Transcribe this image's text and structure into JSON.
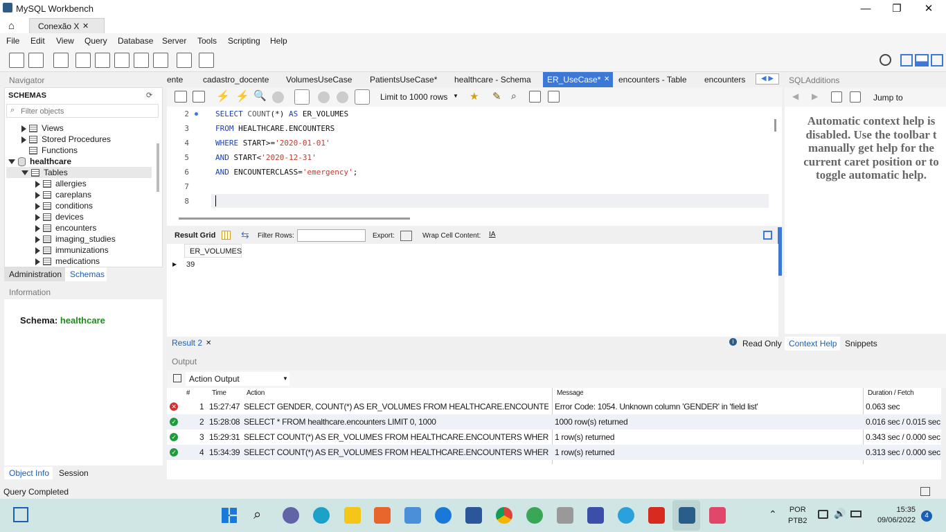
{
  "window": {
    "title": "MySQL Workbench",
    "min": "—",
    "max": "❐",
    "close": "✕"
  },
  "conn_tab": {
    "label": "Conexão X",
    "close": "✕"
  },
  "menu": [
    "File",
    "Edit",
    "View",
    "Query",
    "Database",
    "Server",
    "Tools",
    "Scripting",
    "Help"
  ],
  "navigator": {
    "header": "Navigator",
    "schemas_title": "SCHEMAS",
    "filter_placeholder": "Filter objects",
    "tree": {
      "views": "Views",
      "stored_procedures": "Stored Procedures",
      "functions": "Functions",
      "schema": "healthcare",
      "tables": "Tables",
      "table_list": [
        "allergies",
        "careplans",
        "conditions",
        "devices",
        "encounters",
        "imaging_studies",
        "immunizations",
        "medications"
      ]
    },
    "tabs": {
      "administration": "Administration",
      "schemas": "Schemas"
    }
  },
  "information": {
    "header": "Information",
    "schema_label": "Schema:",
    "schema_value": "healthcare",
    "tabs": {
      "object_info": "Object Info",
      "session": "Session"
    }
  },
  "editor_tabs": [
    "ente",
    "cadastro_docente",
    "VolumesUseCase",
    "PatientsUseCase*",
    "healthcare - Schema",
    "ER_UseCase*",
    "encounters - Table",
    "encounters"
  ],
  "editor_tab_close": "✕",
  "editor_toolbar": {
    "limit": "Limit to 1000 rows"
  },
  "code": {
    "line_numbers": [
      "2",
      "3",
      "4",
      "5",
      "6",
      "7",
      "8"
    ],
    "line2": {
      "kw1": "SELECT ",
      "fn": "COUNT",
      "rest": "(*) ",
      "kw2": "AS ",
      "ident": "ER_VOLUMES"
    },
    "line3": {
      "kw": "FROM ",
      "ident": "HEALTHCARE.ENCOUNTERS"
    },
    "line4": {
      "kw": "WHERE ",
      "ident": "START>=",
      "str": "'2020-01-01'"
    },
    "line5": {
      "kw": "AND ",
      "ident": "START<",
      "str": "'2020-12-31'"
    },
    "line6": {
      "kw": "AND ",
      "ident": "ENCOUNTERCLASS=",
      "str": "'emergency'",
      "end": ";"
    }
  },
  "result_toolbar": {
    "result_grid": "Result Grid",
    "filter_rows": "Filter Rows:",
    "export": "Export:",
    "wrap": "Wrap Cell Content:"
  },
  "result_grid": {
    "column": "ER_VOLUMES",
    "value": "39"
  },
  "result_footer": {
    "tab": "Result 2",
    "close": "✕",
    "read_only": "Read Only"
  },
  "sql_additions": {
    "header": "SQLAdditions",
    "jump_to": "Jump to",
    "help_lines": [
      "Automatic context help is",
      "disabled. Use the toolbar t",
      "manually get help for the",
      "current caret position or to",
      "toggle automatic help."
    ],
    "tabs": {
      "context_help": "Context Help",
      "snippets": "Snippets"
    }
  },
  "output": {
    "header": "Output",
    "selector": "Action Output",
    "columns": {
      "num": "#",
      "time": "Time",
      "action": "Action",
      "message": "Message",
      "duration": "Duration / Fetch"
    },
    "rows": [
      {
        "status": "error",
        "num": "1",
        "time": "15:27:47",
        "action": "SELECT GENDER, COUNT(*) AS ER_VOLUMES FROM HEALTHCARE.ENCOUNTERS ...",
        "message": "Error Code: 1054. Unknown column 'GENDER' in 'field list'",
        "duration": "0.063 sec"
      },
      {
        "status": "ok",
        "num": "2",
        "time": "15:28:08",
        "action": "SELECT * FROM healthcare.encounters LIMIT 0, 1000",
        "message": "1000 row(s) returned",
        "duration": "0.016 sec / 0.015 sec"
      },
      {
        "status": "ok",
        "num": "3",
        "time": "15:29:31",
        "action": "SELECT COUNT(*) AS ER_VOLUMES FROM HEALTHCARE.ENCOUNTERS WHERE S...",
        "message": "1 row(s) returned",
        "duration": "0.343 sec / 0.000 sec"
      },
      {
        "status": "ok",
        "num": "4",
        "time": "15:34:39",
        "action": "SELECT COUNT(*) AS ER_VOLUMES FROM HEALTHCARE.ENCOUNTERS WHERE S...",
        "message": "1 row(s) returned",
        "duration": "0.313 sec / 0.000 sec"
      }
    ]
  },
  "status": {
    "text": "Query Completed"
  },
  "taskbar": {
    "lang1": "POR",
    "lang2": "PTB2",
    "time": "15:35",
    "date": "09/06/2022",
    "badge": "4"
  },
  "colors": {
    "accent": "#1a5fb4",
    "schema_green": "#1e8a1e",
    "keyword": "#1a3fb8",
    "string": "#c0392b",
    "active_tab": "#3b78d8"
  }
}
